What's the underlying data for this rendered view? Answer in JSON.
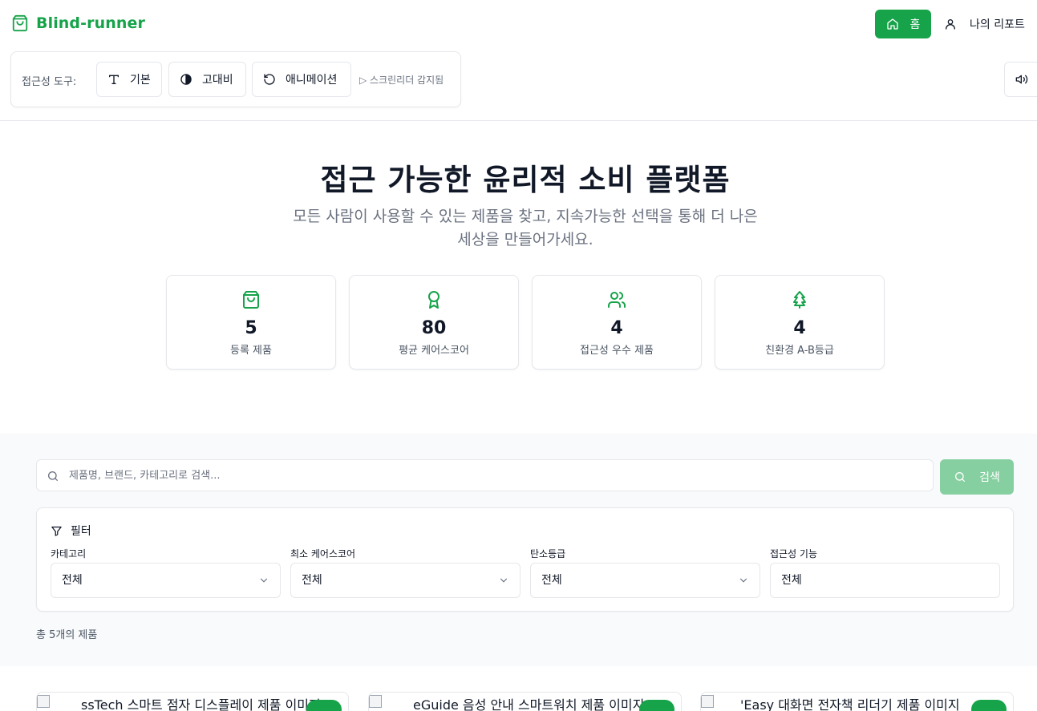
{
  "header": {
    "brand": "Blind-runner",
    "home_label": "홈",
    "report_label": "나의 리포트"
  },
  "a11y_toolbar": {
    "label": "접근성 도구:",
    "buttons": [
      "기본",
      "고대비",
      "애니메이션"
    ],
    "screen_reader_status": "▷ 스크린리더 감지됨"
  },
  "hero": {
    "title": "접근 가능한 윤리적 소비 플랫폼",
    "subtitle_line1": "모든 사람이 사용할 수 있는 제품을 찾고, 지속가능한 선택을 통해 더 나은",
    "subtitle_line2": "세상을 만들어가세요."
  },
  "stats": [
    {
      "value": "5",
      "label": "등록 제품",
      "icon": "shopping-bag-icon"
    },
    {
      "value": "80",
      "label": "평균 케어스코어",
      "icon": "award-icon"
    },
    {
      "value": "4",
      "label": "접근성 우수 제품",
      "icon": "users-icon"
    },
    {
      "value": "4",
      "label": "친환경 A-B등급",
      "icon": "tree-icon"
    }
  ],
  "search": {
    "placeholder": "제품명, 브랜드, 카테고리로 검색...",
    "button_label": "검색"
  },
  "filters": {
    "title": "필터",
    "groups": [
      {
        "label": "카테고리",
        "value": "전체"
      },
      {
        "label": "최소 케어스코어",
        "value": "전체"
      },
      {
        "label": "탄소등급",
        "value": "전체"
      },
      {
        "label": "접근성 기능",
        "value": "전체"
      }
    ]
  },
  "result_count": "총 5개의 제품",
  "products": [
    {
      "alt": "AccessTech 스마트 점자 디스플레이 제품 이미지",
      "alt_visible": "ssTech 스마트 점자 디스플레이 제품 이미지"
    },
    {
      "alt": "VoiceGuide 음성 안내 스마트워치 제품 이미지",
      "alt_visible": "eGuide 음성 안내 스마트워치 제품 이미지"
    },
    {
      "alt": "ReadEasy 대화면 전자책 리더기 제품 이미지",
      "alt_visible": "'Easy 대화면 전자책 리더기 제품 이미지"
    }
  ],
  "colors": {
    "brand": "#16a34a",
    "search_button": "#86cfa0",
    "section_bg": "#f8fafc"
  }
}
